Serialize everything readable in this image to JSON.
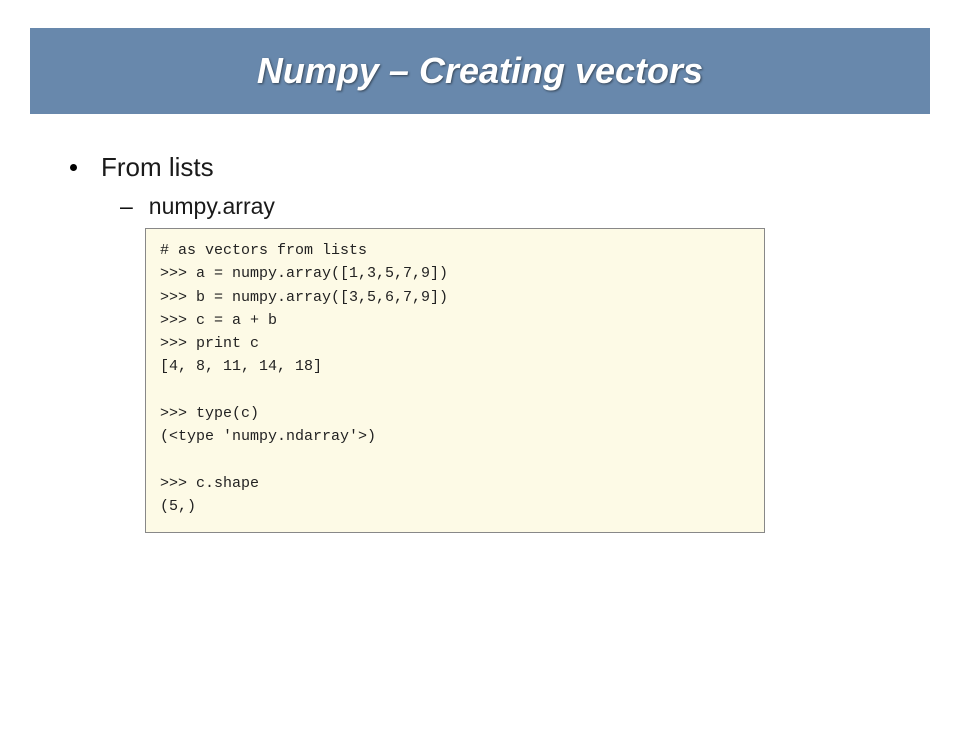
{
  "title": "Numpy – Creating vectors",
  "bullet": "From lists",
  "sub": "numpy.array",
  "code": "# as vectors from lists\n>>> a = numpy.array([1,3,5,7,9])\n>>> b = numpy.array([3,5,6,7,9])\n>>> c = a + b\n>>> print c\n[4, 8, 11, 14, 18]\n\n>>> type(c)\n(<type 'numpy.ndarray'>)\n\n>>> c.shape\n(5,)"
}
